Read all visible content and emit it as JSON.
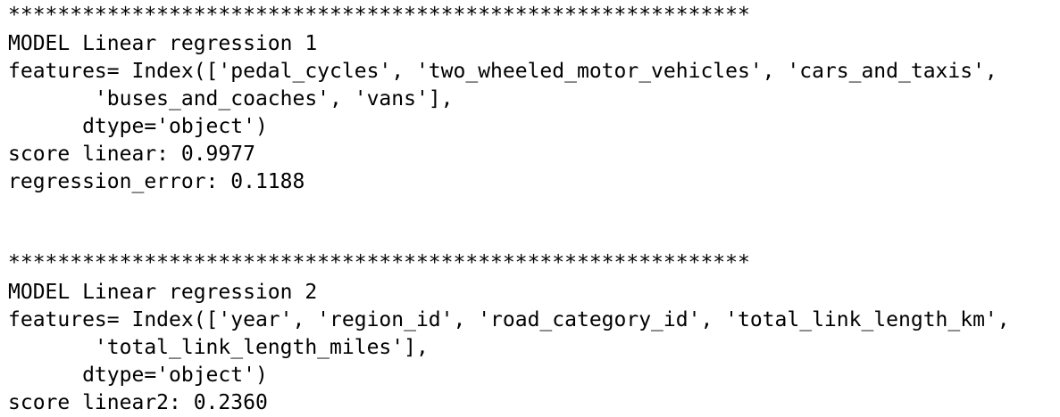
{
  "output": {
    "block1": {
      "separator": "************************************************************",
      "model_line": "MODEL Linear regression 1",
      "features_line1": "features= Index(['pedal_cycles', 'two_wheeled_motor_vehicles', 'cars_and_taxis',",
      "features_line2": "       'buses_and_coaches', 'vans'],",
      "dtype_line": "      dtype='object')",
      "score_line": "score linear: 0.9977",
      "error_line": "regression_error: 0.1188"
    },
    "block2": {
      "separator": "************************************************************",
      "model_line": "MODEL Linear regression 2",
      "features_line1": "features= Index(['year', 'region_id', 'road_category_id', 'total_link_length_km',",
      "features_line2": "       'total_link_length_miles'],",
      "dtype_line": "      dtype='object')",
      "score_line": "score linear2: 0.2360"
    }
  }
}
